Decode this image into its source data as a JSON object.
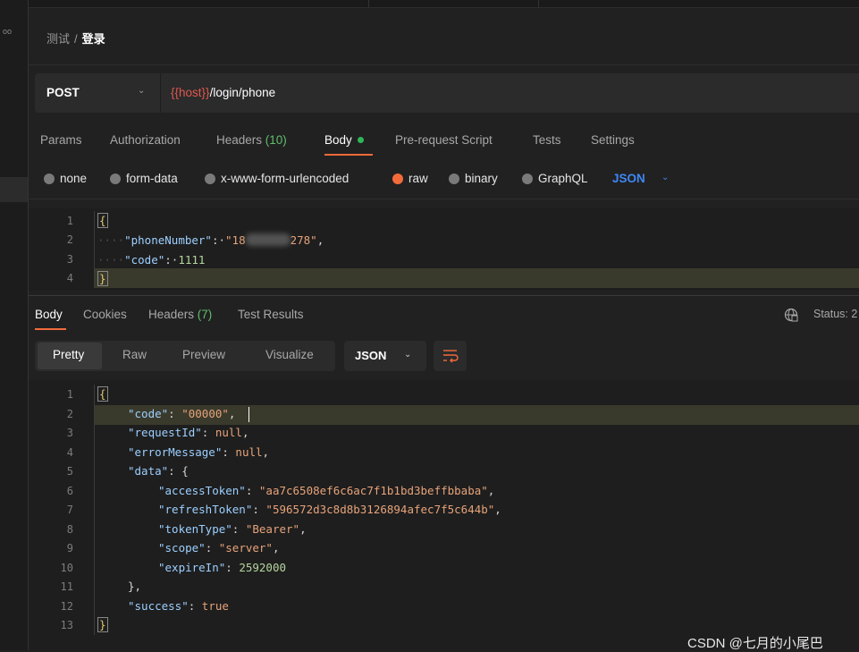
{
  "breadcrumb": {
    "parent": "测试",
    "separator": "/",
    "current": "登录"
  },
  "request": {
    "method": "POST",
    "url_var": "{{host}}",
    "url_path": "/login/phone",
    "tabs": {
      "params": "Params",
      "authorization": "Authorization",
      "headers": "Headers",
      "headers_count": "(10)",
      "body": "Body",
      "pre_request": "Pre-request Script",
      "tests": "Tests",
      "settings": "Settings"
    },
    "body_types": {
      "none": "none",
      "form_data": "form-data",
      "urlencoded": "x-www-form-urlencoded",
      "raw": "raw",
      "binary": "binary",
      "graphql": "GraphQL",
      "selected": "raw"
    },
    "format": "JSON",
    "editor": {
      "line_numbers": [
        "1",
        "2",
        "3",
        "4"
      ],
      "phone_key": "\"phoneNumber\"",
      "phone_prefix": "\"18",
      "phone_suffix": "278\"",
      "code_key": "\"code\"",
      "code_value": "1111"
    }
  },
  "response": {
    "tabs": {
      "body": "Body",
      "cookies": "Cookies",
      "headers": "Headers",
      "headers_count": "(7)",
      "test_results": "Test Results"
    },
    "status_label": "Status: 2",
    "view_modes": {
      "pretty": "Pretty",
      "raw": "Raw",
      "preview": "Preview",
      "visualize": "Visualize"
    },
    "format": "JSON",
    "editor": {
      "line_numbers": [
        "1",
        "2",
        "3",
        "4",
        "5",
        "6",
        "7",
        "8",
        "9",
        "10",
        "11",
        "12",
        "13"
      ],
      "lines": {
        "code_key": "\"code\"",
        "code_val": "\"00000\"",
        "requestId_key": "\"requestId\"",
        "requestId_val": "null",
        "errorMessage_key": "\"errorMessage\"",
        "errorMessage_val": "null",
        "data_key": "\"data\"",
        "accessToken_key": "\"accessToken\"",
        "accessToken_val": "\"aa7c6508ef6c6ac7f1b1bd3beffbbaba\"",
        "refreshToken_key": "\"refreshToken\"",
        "refreshToken_val": "\"596572d3c8d8b3126894afec7f5c644b\"",
        "tokenType_key": "\"tokenType\"",
        "tokenType_val": "\"Bearer\"",
        "scope_key": "\"scope\"",
        "scope_val": "\"server\"",
        "expireIn_key": "\"expireIn\"",
        "expireIn_val": "2592000",
        "success_key": "\"success\"",
        "success_val": "true"
      }
    }
  },
  "watermark": "CSDN @七月的小尾巴",
  "colors": {
    "accent": "#f26b3a",
    "json_key": "#9ccfff",
    "json_string": "#e7a37a",
    "json_number": "#b5d59e",
    "link_blue": "#3e87f5",
    "count_green": "#5fbf6b"
  }
}
